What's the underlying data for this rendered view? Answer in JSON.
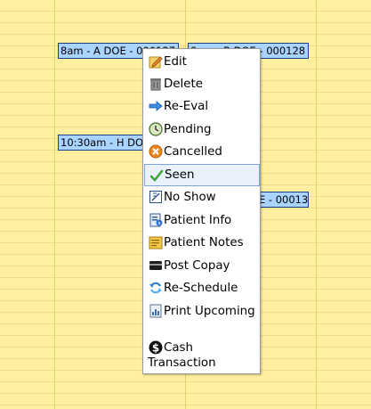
{
  "appointments": [
    {
      "id": "a",
      "text": "8am - A DOE - 000127"
    },
    {
      "id": "b",
      "text": "8am - B DOE - 000128"
    },
    {
      "id": "c",
      "text": "10:30am - H DOE"
    },
    {
      "id": "d",
      "text": "E - 00013"
    }
  ],
  "menu": {
    "items": [
      {
        "label": "Edit",
        "icon": "edit-icon"
      },
      {
        "label": "Delete",
        "icon": "trash-icon"
      },
      {
        "label": "Re-Eval",
        "icon": "arrow-icon"
      },
      {
        "label": "Pending",
        "icon": "clock-icon"
      },
      {
        "label": "Cancelled",
        "icon": "cancel-icon"
      },
      {
        "label": "Seen",
        "icon": "check-icon",
        "highlighted": true
      },
      {
        "label": "No Show",
        "icon": "no-show-icon"
      },
      {
        "label": "Patient Info",
        "icon": "info-doc-icon"
      },
      {
        "label": "Patient Notes",
        "icon": "notes-icon"
      },
      {
        "label": "Post Copay",
        "icon": "card-icon"
      },
      {
        "label": "Re-Schedule",
        "icon": "refresh-icon"
      },
      {
        "label": "Print Upcoming",
        "icon": "chart-doc-icon"
      },
      {
        "label": "Cash Transaction",
        "icon": "dollar-icon"
      }
    ]
  },
  "colors": {
    "calendar_bg": "#ffef9e",
    "appt_bg": "#a9d4ff",
    "appt_border": "#1d3f86",
    "highlight": "#e9f2fb"
  }
}
